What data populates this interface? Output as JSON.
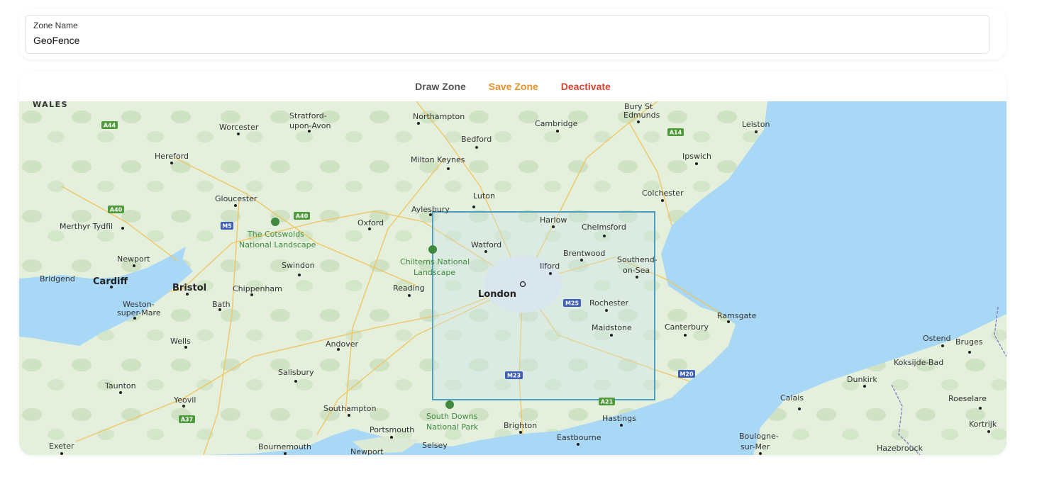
{
  "zone": {
    "label": "Zone Name",
    "value": "GeoFence"
  },
  "toolbar": {
    "draw": "Draw Zone",
    "save": "Save Zone",
    "deactivate": "Deactivate",
    "colors": {
      "draw": "#555555",
      "save": "#e8912d",
      "deactivate": "#d9432f"
    }
  },
  "map": {
    "region": "WALES",
    "cities": {
      "london": "London",
      "bristol": "Bristol",
      "cardiff": "Cardiff",
      "northampton": "Northampton",
      "stratford": "Stratford-",
      "stratford2": "upon-Avon",
      "worcester": "Worcester",
      "hereford": "Hereford",
      "gloucester": "Gloucester",
      "merthyr": "Merthyr Tydfil",
      "newport": "Newport",
      "bridgend": "Bridgend",
      "weston": "Weston-",
      "weston2": "super-Mare",
      "bath": "Bath",
      "chippenham": "Chippenham",
      "swindon": "Swindon",
      "oxford": "Oxford",
      "aylesbury": "Aylesbury",
      "bedford": "Bedford",
      "milton_keynes": "Milton Keynes",
      "luton": "Luton",
      "cambridge": "Cambridge",
      "bury": "Bury St",
      "bury2": "Edmunds",
      "ipswich": "Ipswich",
      "leiston": "Leiston",
      "colchester": "Colchester",
      "harlow": "Harlow",
      "chelmsford": "Chelmsford",
      "watford": "Watford",
      "brentwood": "Brentwood",
      "ilford": "Ilford",
      "southend": "Southend-",
      "southend2": "on-Sea",
      "reading": "Reading",
      "rochester": "Rochester",
      "maidstone": "Maidstone",
      "canterbury": "Canterbury",
      "ramsgate": "Ramsgate",
      "wells": "Wells",
      "andover": "Andover",
      "salisbury": "Salisbury",
      "taunton": "Taunton",
      "yeovil": "Yeovil",
      "southampton": "Southampton",
      "portsmouth": "Portsmouth",
      "brighton": "Brighton",
      "eastbourne": "Eastbourne",
      "hastings": "Hastings",
      "exeter": "Exeter",
      "bournemouth": "Bournemouth",
      "newport_iow": "Newport",
      "selsey": "Selsey",
      "ostend": "Ostend",
      "bruges": "Bruges",
      "koksijde": "Koksijde-Bad",
      "dunkirk": "Dunkirk",
      "calais": "Calais",
      "roeselare": "Roeselare",
      "kortrijk": "Kortrijk",
      "boulogne": "Boulogne-",
      "boulogne2": "sur-Mer",
      "hazebrouck": "Hazebrouck"
    },
    "parks": {
      "cotswolds": "The Cotswolds",
      "cotswolds2": "National Landscape",
      "chilterns": "Chilterns National",
      "chilterns2": "Landscape",
      "south_downs": "South Downs",
      "south_downs2": "National Park"
    },
    "roads": {
      "a44": "A44",
      "a40a": "A40",
      "a40b": "A40",
      "m5": "M5",
      "a14": "A14",
      "m25": "M25",
      "m23": "M23",
      "a21": "A21",
      "m20": "M20",
      "a37": "A37"
    },
    "colors": {
      "sea": "#a8d8f5",
      "land": "#e2eedb",
      "zone_stroke": "#4b9fc2",
      "zone_fill": "#cfe6ee"
    }
  }
}
